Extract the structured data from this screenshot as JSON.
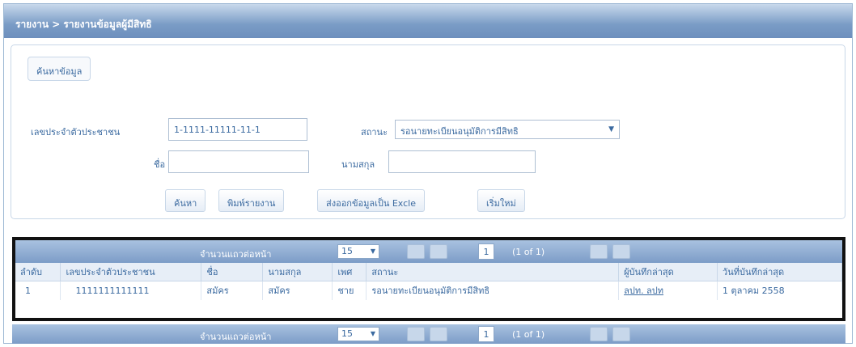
{
  "title": "รายงาน > รายงานข้อมูลผู้มีสิทธิ",
  "search_legend": "ค้นหาข้อมูล",
  "fields": {
    "citizen_id_label": "เลขประจำตัวประชาชน",
    "citizen_id_value": "1-1111-11111-11-1",
    "status_label": "สถานะ",
    "status_value": "รอนายทะเบียนอนุมัติการมีสิทธิ",
    "first_name_label": "ชื่อ",
    "first_name_value": "",
    "last_name_label": "นามสกุล",
    "last_name_value": ""
  },
  "buttons": {
    "search": "ค้นหา",
    "print": "พิมพ์รายงาน",
    "export": "ส่งออกข้อมูลเป็น Excle",
    "reset": "เริ่มใหม่"
  },
  "pager": {
    "rows_per_page_label": "จำนวนแถวต่อหน้า",
    "rows_per_page_value": "15",
    "current_page": "1",
    "of_pages": "(1 of 1)"
  },
  "table": {
    "headers": [
      "ลำดับ",
      "เลขประจำตัวประชาชน",
      "ชื่อ",
      "นามสกุล",
      "เพศ",
      "สถานะ",
      "ผู้บันทึกล่าสุด",
      "วันที่บันทึกล่าสุด"
    ],
    "rows": [
      [
        "1",
        "1111111111111",
        "สมัคร",
        "สมัคร",
        "ชาย",
        "รอนายทะเบียนอนุมัติการมีสิทธิ",
        "ลปท. ลปท",
        "1 ตุลาคม 2558"
      ]
    ]
  }
}
